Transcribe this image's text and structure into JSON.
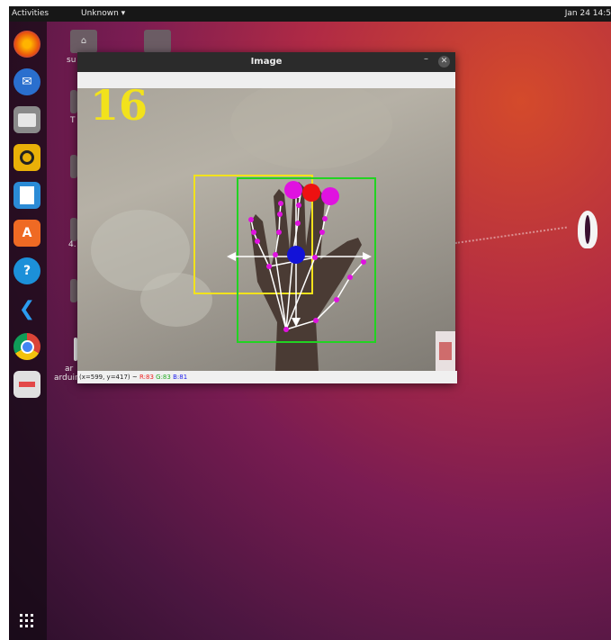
{
  "topbar": {
    "activities": "Activities",
    "app_menu": "Unknown ▾",
    "clock": "Jan 24 14:5"
  },
  "dock": {
    "items": [
      "firefox",
      "thunderbird",
      "files",
      "rhythmbox",
      "libreoffice-writer",
      "software",
      "help",
      "vscode",
      "chrome",
      "document-viewer"
    ],
    "show_apps_icon": "grid-icon"
  },
  "desktop": {
    "labels": [
      "su",
      "T",
      "4.",
      "ar",
      "arduin"
    ]
  },
  "window": {
    "title": "Image",
    "minimize": "–",
    "close": "✕",
    "overlay_count": "16",
    "status": {
      "coords": "(x=599, y=417) ~",
      "r": "R:83",
      "g": "G:83",
      "b": "B:81"
    }
  },
  "colors": {
    "yellow_box": "#f2e21c",
    "green_box": "#22d322",
    "landmark": "#e012e0",
    "center_dot": "#1212d8",
    "red_dot": "#ee1111"
  }
}
